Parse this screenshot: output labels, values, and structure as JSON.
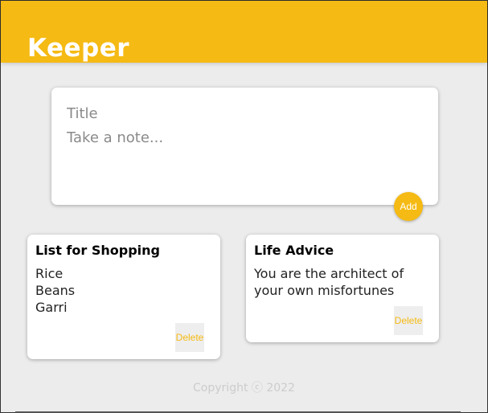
{
  "header": {
    "title": "Keeper"
  },
  "compose": {
    "title_placeholder": "Title",
    "content_placeholder": "Take a note...",
    "add_label": "Add"
  },
  "notes": [
    {
      "title": "List for Shopping",
      "content": "Rice\nBeans\nGarri",
      "delete_label": "Delete"
    },
    {
      "title": "Life Advice",
      "content": "You are the architect of your own misfortunes",
      "delete_label": "Delete"
    }
  ],
  "footer": {
    "copyright": "Copyright ⓒ 2022"
  },
  "colors": {
    "accent": "#f5ba13",
    "background": "#ececec"
  }
}
